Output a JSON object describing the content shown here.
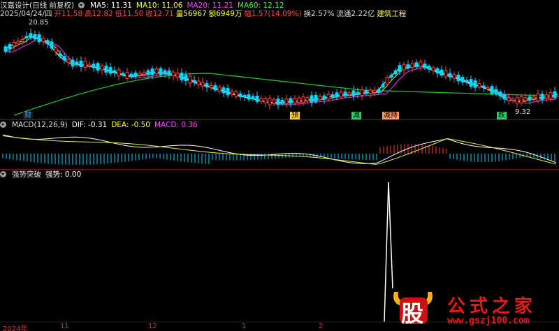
{
  "header": {
    "title": "汉嘉设计(日线 前复权)",
    "ma5": "MA5: 11.31",
    "ma10": "MA10: 11.06",
    "ma20": "MA20: 11.21",
    "ma60": "MA60: 12.12",
    "date": "2025/04/24/四",
    "open": "开11.58",
    "high": "高12.82",
    "low": "低11.50",
    "close": "收12.71",
    "volume": "量56967",
    "amount": "额6949万",
    "change": "幅1.57(14.09%)",
    "turnover": "换2.57%",
    "float_cap": "流通2.22亿",
    "industry": "建筑工程"
  },
  "price_pane": {
    "max_label": "20.85",
    "min_label": "9.32",
    "event_tags": [
      "财",
      "预",
      "减",
      "减持",
      "跌"
    ]
  },
  "macd_pane": {
    "title": "MACD(12,26,9)",
    "dif": "DIF: -0.31",
    "dea": "DEA: -0.50",
    "macd": "MACD: 0.36"
  },
  "signal_pane": {
    "title": "强势突破",
    "value_label": "强势: 0.00"
  },
  "x_axis": {
    "labels": [
      "2024年",
      "11",
      "12",
      "1",
      "2"
    ]
  },
  "watermark": {
    "left": "股",
    "right": "公式之家",
    "url": "www.gszj100.com"
  },
  "colors": {
    "up": "#ff3b3b",
    "down": "#00e0ff",
    "ma5": "#ffffff",
    "ma10": "#ffff00",
    "ma20": "#ff00ff",
    "ma60": "#00ff00",
    "border": "#7a1010"
  }
}
